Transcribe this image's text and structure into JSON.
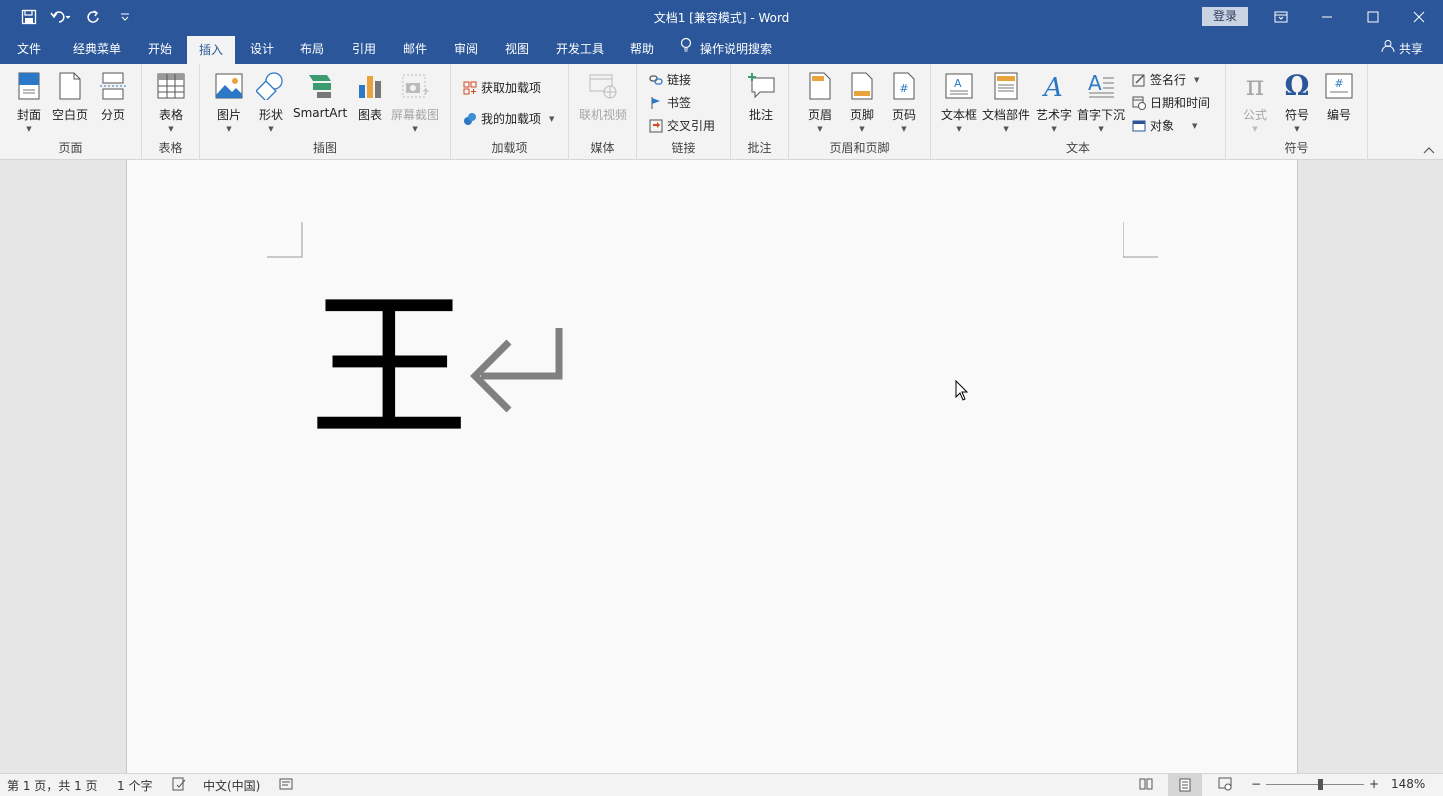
{
  "window": {
    "title": "文档1 [兼容模式] - Word",
    "login_label": "登录"
  },
  "tabs": [
    {
      "label": "文件"
    },
    {
      "label": "经典菜单"
    },
    {
      "label": "开始"
    },
    {
      "label": "插入"
    },
    {
      "label": "设计"
    },
    {
      "label": "布局"
    },
    {
      "label": "引用"
    },
    {
      "label": "邮件"
    },
    {
      "label": "审阅"
    },
    {
      "label": "视图"
    },
    {
      "label": "开发工具"
    },
    {
      "label": "帮助"
    },
    {
      "label": "操作说明搜索"
    }
  ],
  "active_tab": "插入",
  "share_label": "共享",
  "ribbon": {
    "pages": {
      "label": "页面",
      "cover": "封面",
      "blank": "空白页",
      "break": "分页"
    },
    "tables": {
      "label": "表格",
      "table": "表格"
    },
    "illustrations": {
      "label": "插图",
      "picture": "图片",
      "shapes": "形状",
      "smartart": "SmartArt",
      "chart": "图表",
      "screenshot": "屏幕截图"
    },
    "addins": {
      "label": "加载项",
      "get": "获取加载项",
      "mine": "我的加载项"
    },
    "media": {
      "label": "媒体",
      "video": "联机视频"
    },
    "links": {
      "label": "链接",
      "link": "链接",
      "bookmark": "书签",
      "crossref": "交叉引用"
    },
    "comments": {
      "label": "批注",
      "comment": "批注"
    },
    "headerfooter": {
      "label": "页眉和页脚",
      "header": "页眉",
      "footer": "页脚",
      "pagenum": "页码"
    },
    "text": {
      "label": "文本",
      "textbox": "文本框",
      "parts": "文档部件",
      "wordart": "艺术字",
      "dropcap": "首字下沉",
      "signature": "签名行",
      "datetime": "日期和时间",
      "object": "对象"
    },
    "symbols": {
      "label": "符号",
      "equation": "公式",
      "symbol": "符号",
      "number": "编号"
    }
  },
  "document": {
    "content": "王"
  },
  "status": {
    "page": "第 1 页，共 1 页",
    "words": "1 个字",
    "language": "中文(中国)",
    "zoom": "148%",
    "zoom_minus": "−",
    "zoom_plus": "+"
  },
  "colors": {
    "brand": "#2b579a",
    "ribbon_bg": "#f3f3f3"
  }
}
